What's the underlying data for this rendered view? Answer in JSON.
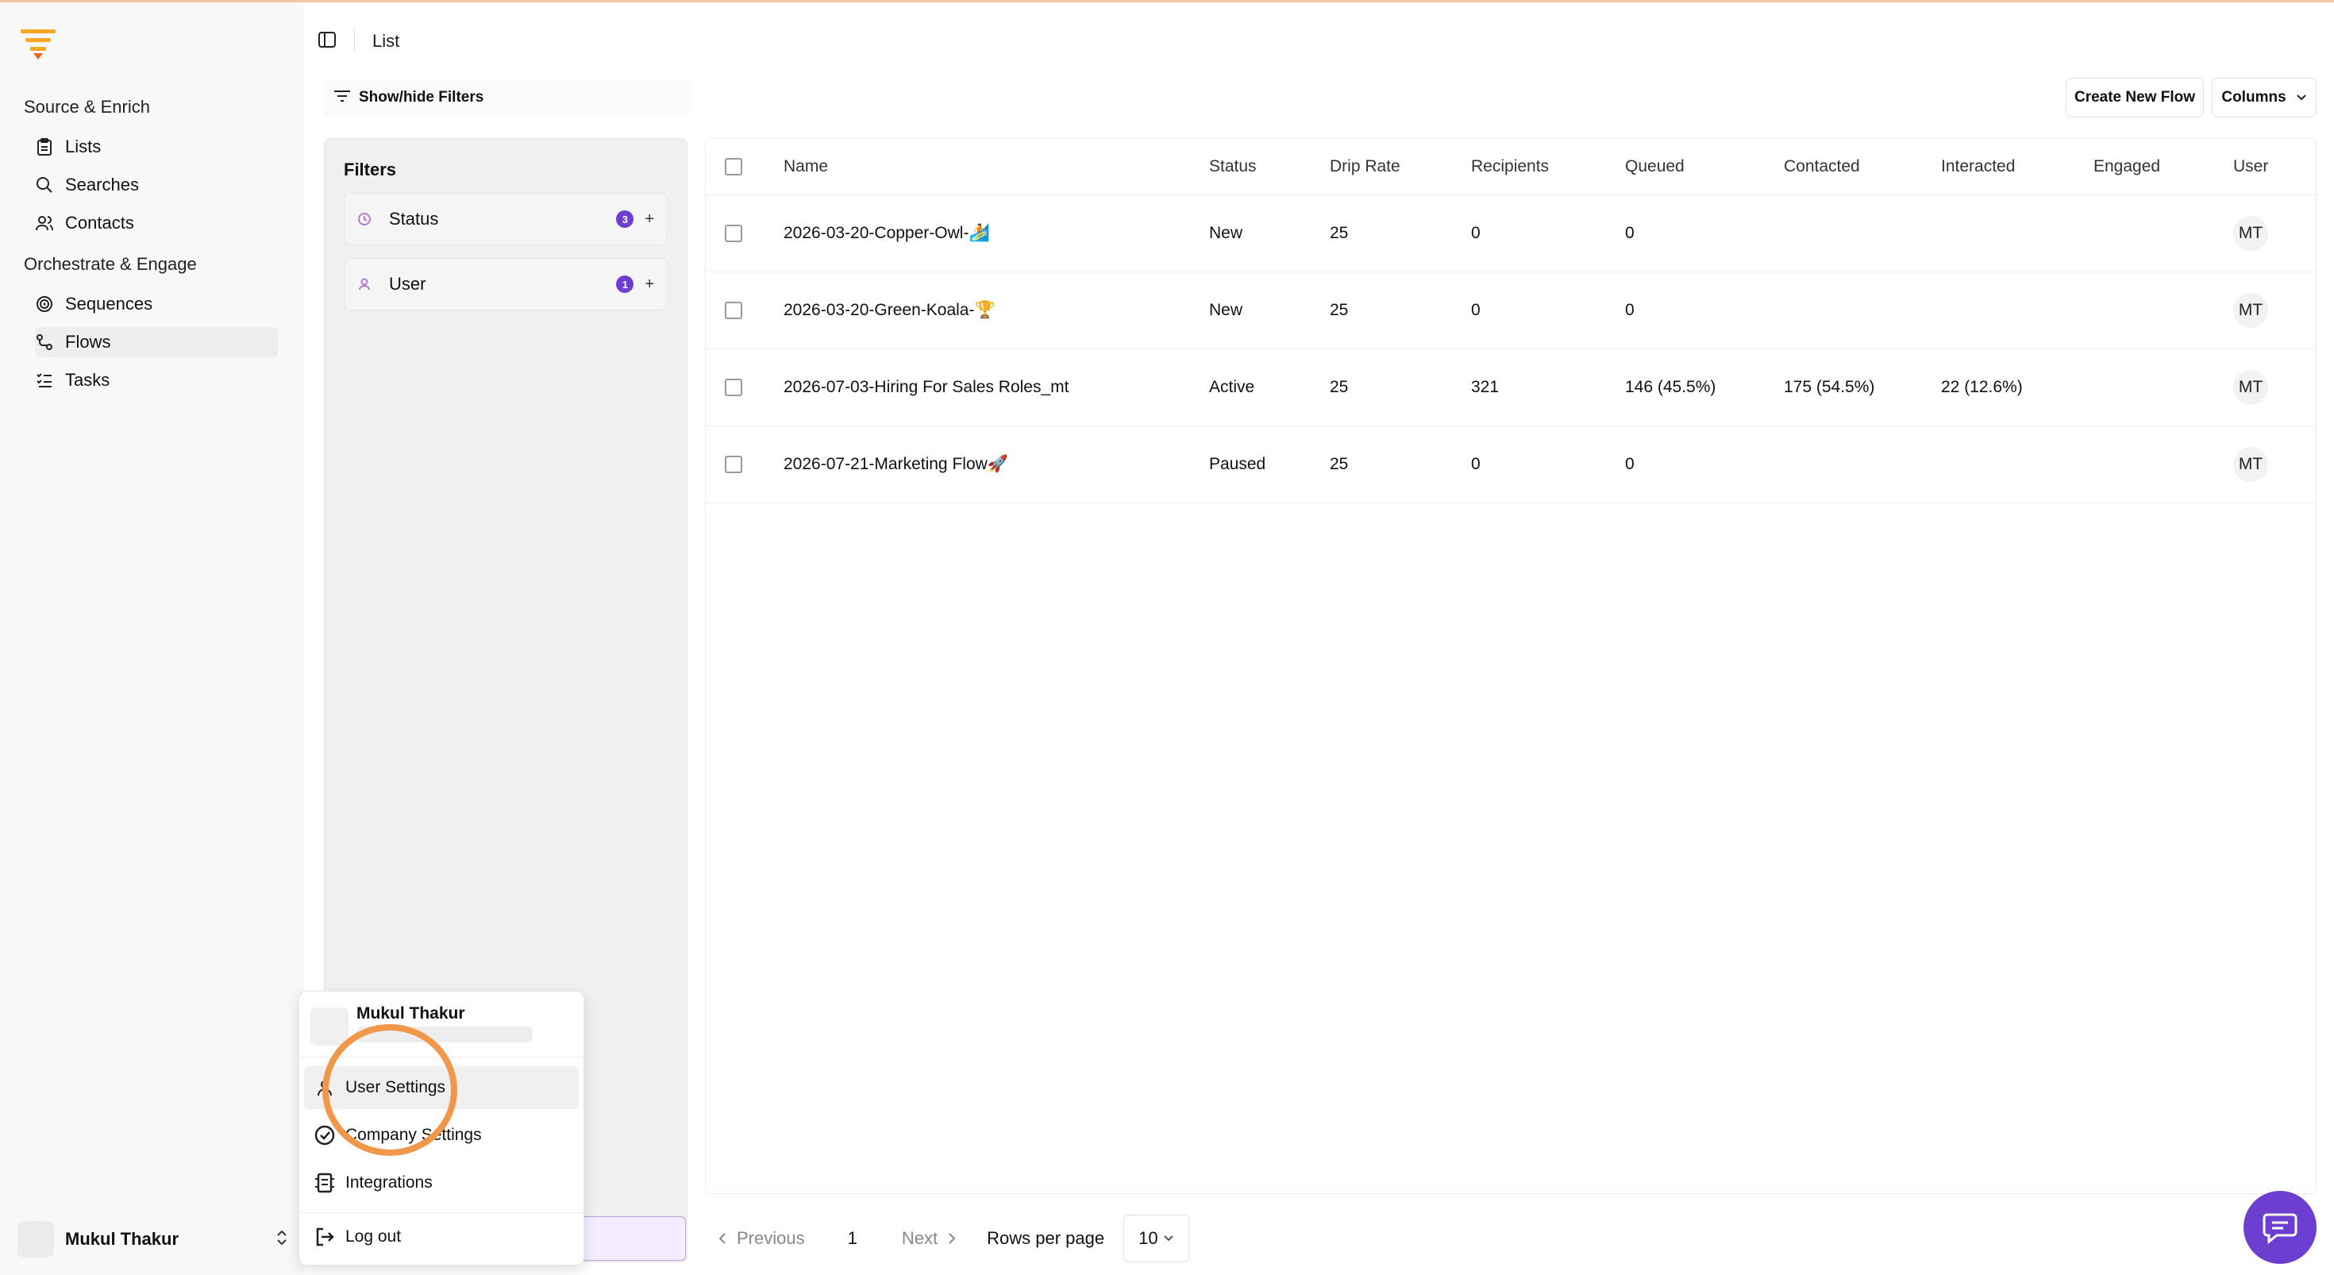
{
  "sidebar": {
    "group1": "Source & Enrich",
    "group2": "Orchestrate & Engage",
    "items": [
      {
        "label": "Lists",
        "icon": "clipboard-icon"
      },
      {
        "label": "Searches",
        "icon": "search-icon"
      },
      {
        "label": "Contacts",
        "icon": "users-icon"
      },
      {
        "label": "Sequences",
        "icon": "target-icon"
      },
      {
        "label": "Flows",
        "icon": "flow-icon"
      },
      {
        "label": "Tasks",
        "icon": "checklist-icon"
      }
    ],
    "user_name": "Mukul Thakur"
  },
  "header": {
    "crumb": "List"
  },
  "toolbar": {
    "filters_toggle": "Show/hide Filters",
    "create": "Create New Flow",
    "columns": "Columns"
  },
  "filters": {
    "title": "Filters",
    "items": [
      {
        "label": "Status",
        "count": "3"
      },
      {
        "label": "User",
        "count": "1"
      }
    ]
  },
  "table": {
    "headers": [
      "Name",
      "Status",
      "Drip Rate",
      "Recipients",
      "Queued",
      "Contacted",
      "Interacted",
      "Engaged",
      "User"
    ],
    "rows": [
      {
        "name": "2026-03-20-Copper-Owl-🏄",
        "status": "New",
        "drip": "25",
        "recipients": "0",
        "queued": "0",
        "contacted": "",
        "interacted": "",
        "engaged": "",
        "user": "MT"
      },
      {
        "name": "2026-03-20-Green-Koala-🏆",
        "status": "New",
        "drip": "25",
        "recipients": "0",
        "queued": "0",
        "contacted": "",
        "interacted": "",
        "engaged": "",
        "user": "MT"
      },
      {
        "name": "2026-07-03-Hiring For Sales Roles_mt",
        "status": "Active",
        "drip": "25",
        "recipients": "321",
        "queued": "146 (45.5%)",
        "contacted": "175 (54.5%)",
        "interacted": "22 (12.6%)",
        "engaged": "",
        "user": "MT"
      },
      {
        "name": "2026-07-21-Marketing Flow🚀",
        "status": "Paused",
        "drip": "25",
        "recipients": "0",
        "queued": "0",
        "contacted": "",
        "interacted": "",
        "engaged": "",
        "user": "MT"
      }
    ]
  },
  "pager": {
    "previous": "Previous",
    "page": "1",
    "next": "Next",
    "rows_label": "Rows per page",
    "rows_value": "10"
  },
  "popup": {
    "name": "Mukul Thakur",
    "items": [
      "User Settings",
      "Company Settings",
      "Integrations",
      "Log out"
    ]
  },
  "colors": {
    "accent": "#6d3fd1",
    "highlight_ring": "#f0974a",
    "logo": "#f5a623"
  }
}
